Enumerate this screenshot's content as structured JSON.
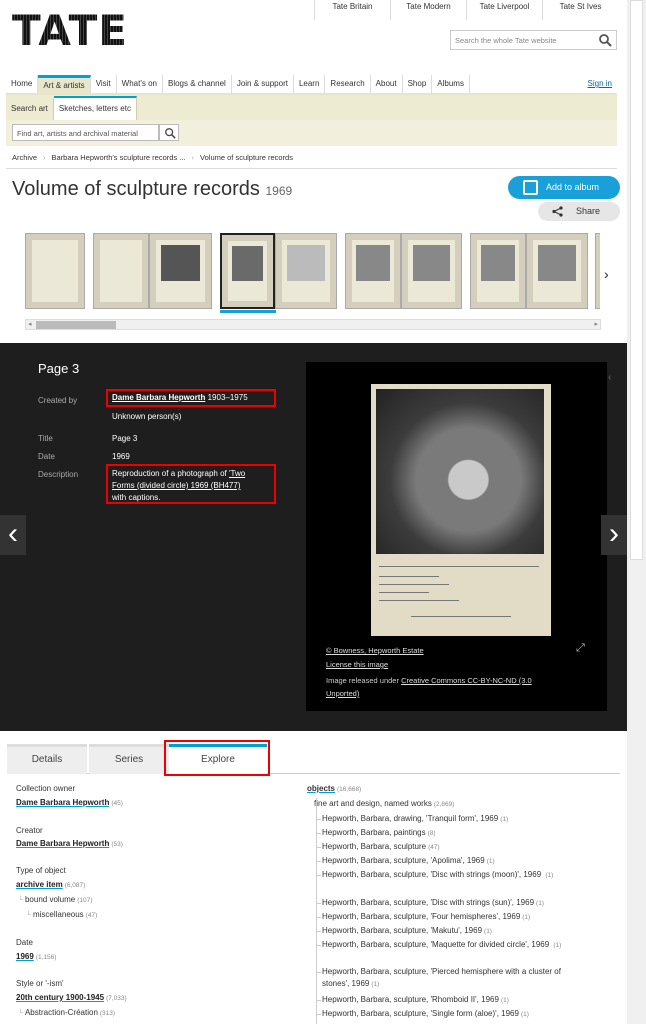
{
  "logo": "TATE",
  "sites": [
    "Tate Britain",
    "Tate Modern",
    "Tate Liverpool",
    "Tate St Ives"
  ],
  "search": {
    "placeholder": "Search the whole Tate website"
  },
  "mainnav": [
    "Home",
    "Art & artists",
    "Visit",
    "What's on",
    "Blogs & channel",
    "Join & support",
    "Learn",
    "Research",
    "About",
    "Shop",
    "Albums"
  ],
  "signin": "Sign in",
  "subnav": [
    "Search art",
    "Sketches, letters etc"
  ],
  "finder": {
    "placeholder": "Find art, artists and archival material"
  },
  "breadcrumbs": [
    "Archive",
    "Barbara Hepworth's sculpture records ...",
    "Volume of sculpture records"
  ],
  "title": "Volume of sculpture records",
  "title_year": "1969",
  "add_album": "Add to album",
  "share": "Share",
  "viewer": {
    "page_title": "Page 3",
    "created_by_label": "Created by",
    "creator_name": "Dame Barbara Hepworth",
    "creator_dates": "1903–1975",
    "creator_2": "Unknown person(s)",
    "title_label": "Title",
    "title_value": "Page 3",
    "date_label": "Date",
    "date_value": "1969",
    "description_label": "Description",
    "description_1": "Reproduction of a photograph of ",
    "description_link_1": "'Two",
    "description_link_2": "Forms (divided circle) 1969 (BH477)",
    "description_2": "with captions.",
    "copyright": "© Bowness, Hepworth Estate",
    "license": "License this image",
    "released": "Image released under ",
    "cc_1": "Creative Commons CC-BY-NC-ND (3.0",
    "cc_2": "Unported)"
  },
  "tabs": [
    "Details",
    "Series",
    "Explore"
  ],
  "left_facets": {
    "collection_owner_label": "Collection owner",
    "collection_owner": "Dame Barbara Hepworth",
    "collection_owner_count": "(45)",
    "creator_label": "Creator",
    "creator": "Dame Barbara Hepworth",
    "creator_count": "(53)",
    "type_label": "Type of object",
    "type": "archive item",
    "type_count": "(6,087)",
    "type_sub_1": "bound volume",
    "type_sub_1_count": "(107)",
    "type_sub_2": "miscellaneous",
    "type_sub_2_count": "(47)",
    "date_label": "Date",
    "date": "1969",
    "date_count": "(1,156)",
    "style_label": "Style or '-ism'",
    "style": "20th century 1900-1945",
    "style_count": "(7,033)",
    "style_sub_1": "Abstraction-Création",
    "style_sub_1_count": "(313)"
  },
  "right_facets": {
    "objects": "objects",
    "objects_count": "(16,668)",
    "group": "fine art and design, named works",
    "group_count": "(2,869)",
    "items": [
      {
        "t": "Hepworth, Barbara, drawing, 'Tranquil form', 1969",
        "c": "(1)"
      },
      {
        "t": "Hepworth, Barbara, paintings",
        "c": "(8)"
      },
      {
        "t": "Hepworth, Barbara, sculpture",
        "c": "(47)"
      },
      {
        "t": "Hepworth, Barbara, sculpture, 'Apolima', 1969",
        "c": "(1)"
      },
      {
        "t": "Hepworth, Barbara, sculpture, 'Disc with strings (moon)', 1969",
        "c": "(1)"
      },
      {
        "t": "Hepworth, Barbara, sculpture, 'Disc with strings (sun)', 1969",
        "c": "(1)"
      },
      {
        "t": "Hepworth, Barbara, sculpture, 'Four hemispheres', 1969",
        "c": "(1)"
      },
      {
        "t": "Hepworth, Barbara, sculpture, 'Makutu', 1969",
        "c": "(1)"
      },
      {
        "t": "Hepworth, Barbara, sculpture, 'Maquette for divided circle', 1969",
        "c": "(1)"
      },
      {
        "t": "Hepworth, Barbara, sculpture, 'Pierced hemisphere with a cluster of stones', 1969",
        "c": "(1)"
      },
      {
        "t": "Hepworth, Barbara, sculpture, 'Rhomboid II', 1969",
        "c": "(1)"
      },
      {
        "t": "Hepworth, Barbara, sculpture, 'Single form (aloe)', 1969",
        "c": "(1)"
      }
    ]
  }
}
